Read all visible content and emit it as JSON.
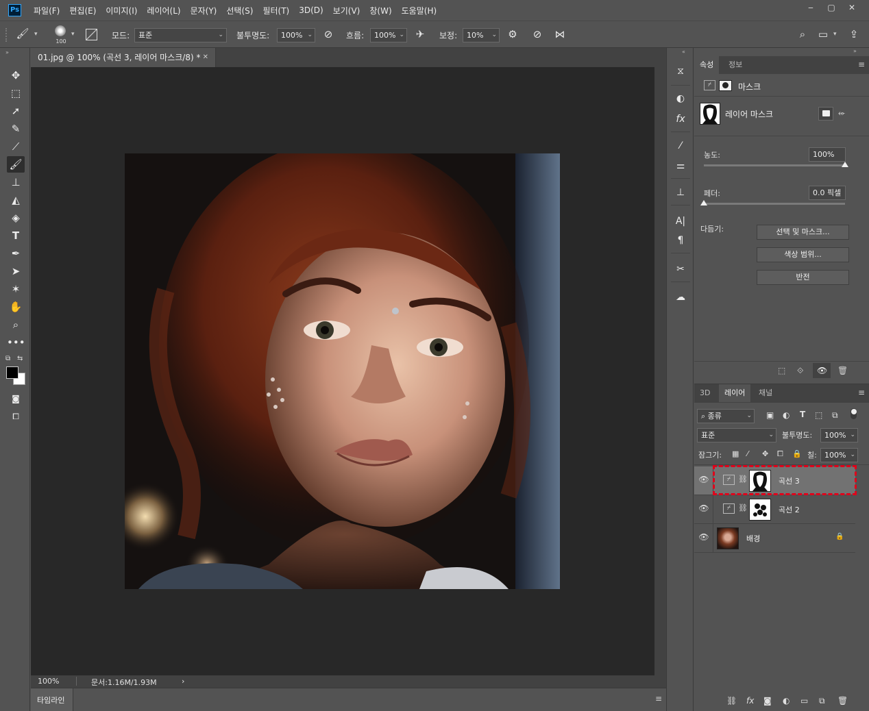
{
  "app": {
    "logo": "Ps",
    "menu": [
      "파일(F)",
      "편집(E)",
      "이미지(I)",
      "레이어(L)",
      "문자(Y)",
      "선택(S)",
      "필터(T)",
      "3D(D)",
      "보기(V)",
      "창(W)",
      "도움말(H)"
    ],
    "window_controls": [
      "‒",
      "▢",
      "✕"
    ]
  },
  "options": {
    "brush_size": "100",
    "mode_label": "모드:",
    "mode_value": "표준",
    "opacity_label": "불투명도:",
    "opacity_value": "100%",
    "flow_label": "흐름:",
    "flow_value": "100%",
    "smoothing_label": "보정:",
    "smoothing_value": "10%"
  },
  "document": {
    "tab_title": "01.jpg @ 100% (곡선 3, 레이어 마스크/8) *",
    "zoom": "100%",
    "doc_info": "문서:1.16M/1.93M",
    "timeline_label": "타임라인"
  },
  "properties": {
    "tabs": [
      "속성",
      "정보"
    ],
    "mask_header": "마스크",
    "mask_type": "레이어 마스크",
    "density_label": "농도:",
    "density_value": "100%",
    "density_level": 1.0,
    "feather_label": "페더:",
    "feather_value": "0.0 픽셀",
    "feather_level": 0.0,
    "refine_label": "다듬기:",
    "btn_select_mask": "선택 및 마스크...",
    "btn_color_range": "색상 범위...",
    "btn_invert": "반전"
  },
  "layers": {
    "tabs": [
      "3D",
      "레이어",
      "채널"
    ],
    "filter_kind": "종류",
    "blend_mode": "표준",
    "opacity_label": "불투명도:",
    "opacity_value": "100%",
    "lock_label": "잠그기:",
    "fill_label": "칠:",
    "fill_value": "100%",
    "items": [
      {
        "name": "곡선 3",
        "selected": true
      },
      {
        "name": "곡선 2",
        "selected": false
      },
      {
        "name": "배경",
        "selected": false
      }
    ]
  },
  "colors": {
    "accent": "#31a8ff",
    "selection_outline": "#e0001a",
    "panel_bg": "#535353",
    "canvas_bg": "#282828"
  }
}
